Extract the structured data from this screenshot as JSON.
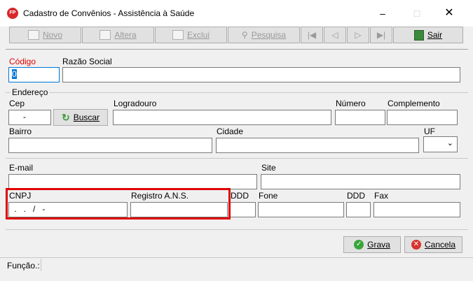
{
  "window": {
    "title": "Cadastro de Convênios - Assistência à Saúde",
    "icon_text": "FP"
  },
  "toolbar": {
    "novo": "Novo",
    "altera": "Altera",
    "exclui": "Exclui",
    "pesquisa": "Pesquisa",
    "sair": "Sair"
  },
  "form": {
    "codigo_label": "Código",
    "codigo_value": "0",
    "razao_label": "Razão Social",
    "endereco_label": "Endereço",
    "cep_label": "Cep",
    "cep_value": "-",
    "buscar": "Buscar",
    "logradouro_label": "Logradouro",
    "numero_label": "Número",
    "complemento_label": "Complemento",
    "bairro_label": "Bairro",
    "cidade_label": "Cidade",
    "uf_label": "UF",
    "email_label": "E-mail",
    "site_label": "Site",
    "cnpj_label": "CNPJ",
    "cnpj_value": " .   .   /   -",
    "ans_label": "Registro A.N.S.",
    "ddd_label": "DDD",
    "fone_label": "Fone",
    "ddd2_label": "DDD",
    "fax_label": "Fax"
  },
  "actions": {
    "grava": "Grava",
    "cancela": "Cancela"
  },
  "status": {
    "funcao_label": "Função.:"
  }
}
